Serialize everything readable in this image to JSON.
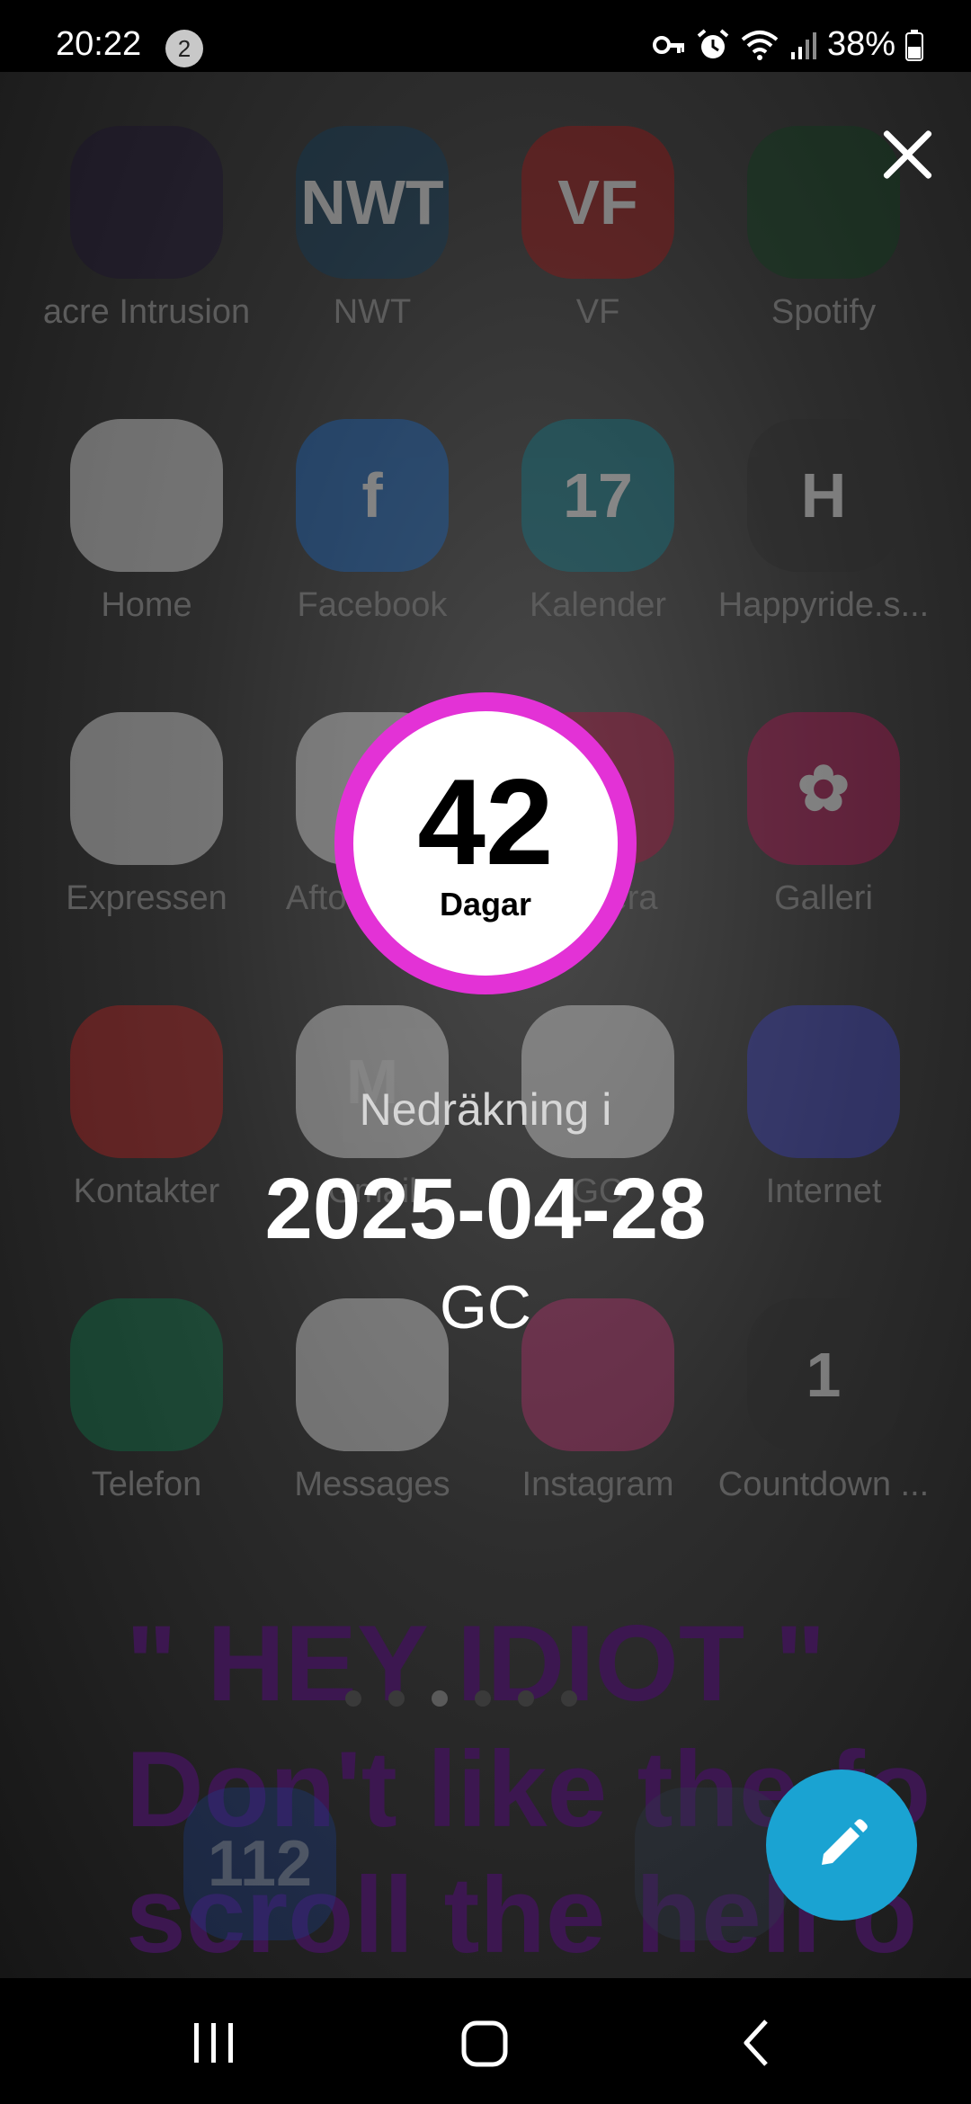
{
  "status_bar": {
    "time": "20:22",
    "notification_count": "2",
    "battery_percent": "38%",
    "icons": [
      "vpn-key-icon",
      "alarm-icon",
      "wifi-icon",
      "signal-icon",
      "battery-icon"
    ]
  },
  "home_apps": [
    {
      "label": "acre Intrusion",
      "color": "#1a1030",
      "glyph": ""
    },
    {
      "label": "NWT",
      "color": "#0d3a5a",
      "glyph": "NWT"
    },
    {
      "label": "VF",
      "color": "#a01010",
      "glyph": "VF"
    },
    {
      "label": "Spotify",
      "color": "#0a3d1a",
      "glyph": ""
    },
    {
      "label": "Home",
      "color": "#e8e8e8",
      "glyph": ""
    },
    {
      "label": "Facebook",
      "color": "#1565c0",
      "glyph": "f"
    },
    {
      "label": "Kalender",
      "color": "#0b7a8a",
      "glyph": "17"
    },
    {
      "label": "Happyride.s...",
      "color": "#2a2a2a",
      "glyph": "H"
    },
    {
      "label": "Expressen",
      "color": "#e8e8e8",
      "glyph": ""
    },
    {
      "label": "Aftonbladet",
      "color": "#e8e8e8",
      "glyph": ""
    },
    {
      "label": "Kamera",
      "color": "#b01040",
      "glyph": ""
    },
    {
      "label": "Galleri",
      "color": "#b01050",
      "glyph": "✿"
    },
    {
      "label": "Kontakter",
      "color": "#c02020",
      "glyph": ""
    },
    {
      "label": "Gmail",
      "color": "#e8e8e8",
      "glyph": "M"
    },
    {
      "label": "GC",
      "color": "#e8e8e8",
      "glyph": ""
    },
    {
      "label": "Internet",
      "color": "#3a40c0",
      "glyph": ""
    },
    {
      "label": "Telefon",
      "color": "#0a7a4a",
      "glyph": ""
    },
    {
      "label": "Messages",
      "color": "#e8e8e8",
      "glyph": ""
    },
    {
      "label": "Instagram",
      "color": "#c03070",
      "glyph": ""
    },
    {
      "label": "Countdown ...",
      "color": "#2a2a2a",
      "glyph": "1"
    }
  ],
  "background_text": {
    "line1": "\" HEY IDIOT \"",
    "line2": "Don't like the fo",
    "line3": "scroll the hell o"
  },
  "dock": {
    "emergency_label": "112"
  },
  "countdown": {
    "days_value": "42",
    "days_unit": "Dagar",
    "title": "Nedräkning i",
    "date": "2025-04-28",
    "name": "GC",
    "ring_color": "#e332d6"
  },
  "fab": {
    "icon": "pencil-icon",
    "color": "#1aa3d2"
  },
  "navbar": {
    "recents_icon": "recents-icon",
    "home_icon": "home-icon",
    "back_icon": "back-icon"
  }
}
